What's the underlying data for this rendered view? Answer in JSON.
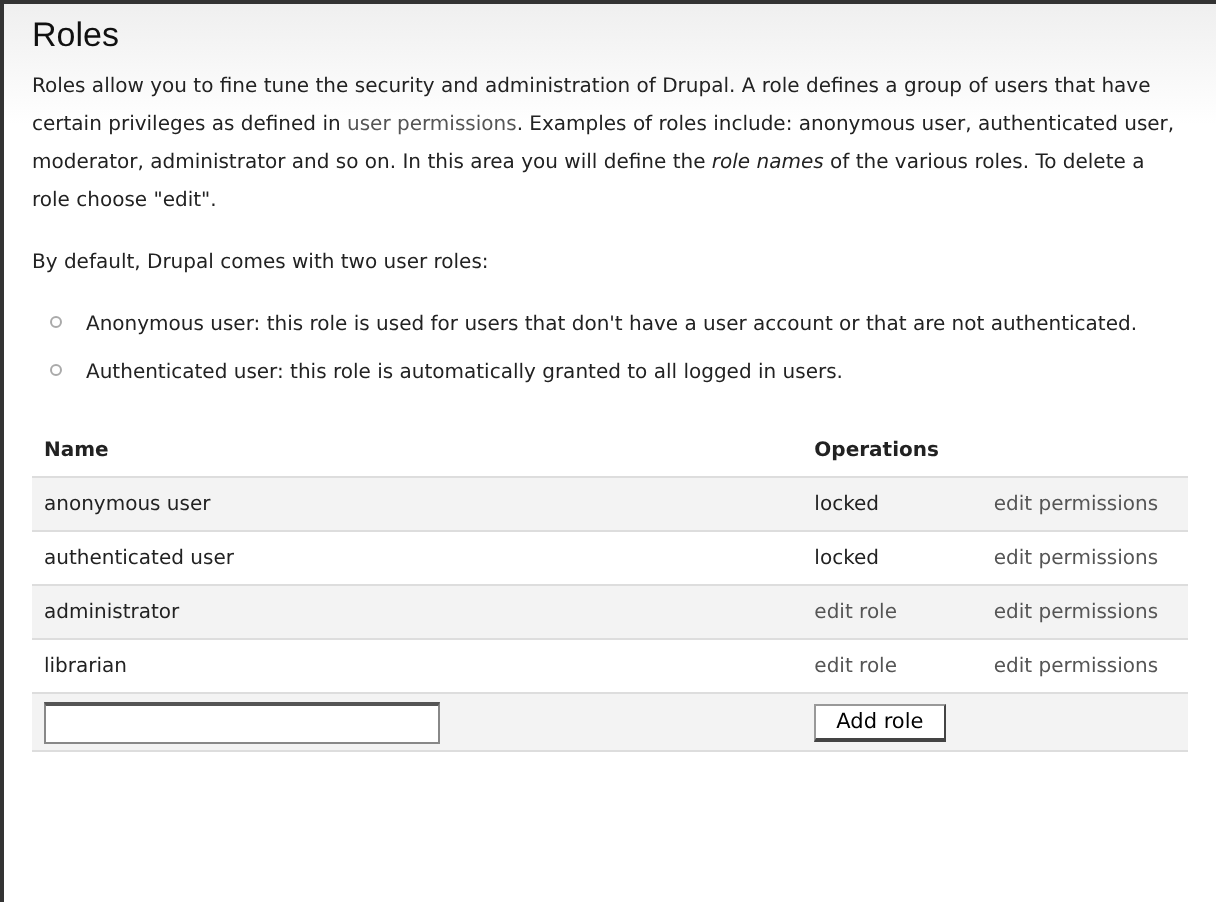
{
  "title": "Roles",
  "intro": {
    "before": "Roles allow you to fine tune the security and administration of Drupal. A role defines a group of users that have certain privileges as defined in",
    "link": "user permissions",
    "after": ". Examples of roles include: anonymous user, authenticated user, moderator, administrator and so on. In this area you will define the *role names* of the various roles. To delete a role choose \"edit\"."
  },
  "default_note": "By default, Drupal comes with two user roles:",
  "default_roles": [
    "Anonymous user: this role is used for users that don't have a user account or that are not authenticated.",
    "Authenticated user: this role is automatically granted to all logged in users."
  ],
  "table": {
    "columns": [
      "Name",
      "Operations"
    ],
    "rows": [
      {
        "name": "anonymous user",
        "operations": [
          {
            "kind": "text",
            "label": "locked"
          },
          {
            "kind": "link",
            "label": "edit permissions"
          }
        ]
      },
      {
        "name": "authenticated user",
        "operations": [
          {
            "kind": "text",
            "label": "locked"
          },
          {
            "kind": "link",
            "label": "edit permissions"
          }
        ]
      },
      {
        "name": "administrator",
        "operations": [
          {
            "kind": "link",
            "label": "edit role"
          },
          {
            "kind": "link",
            "label": "edit permissions"
          }
        ]
      },
      {
        "name": "librarian",
        "operations": [
          {
            "kind": "link",
            "label": "edit role"
          },
          {
            "kind": "link",
            "label": "edit permissions"
          }
        ]
      }
    ]
  },
  "add_button": "Add role"
}
